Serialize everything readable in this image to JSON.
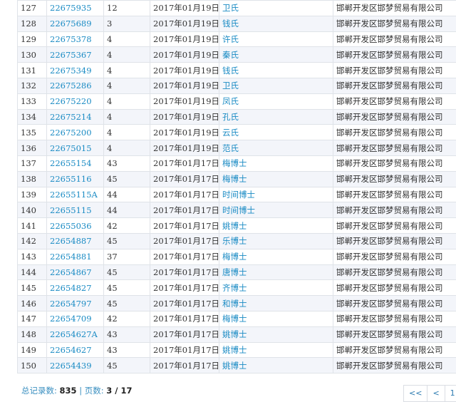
{
  "rows": [
    {
      "idx": "127",
      "reg": "22675935",
      "cls": "12",
      "date": "2017年01月19日",
      "name": "卫氏",
      "owner": "邯郸开发区邯梦贸易有限公司"
    },
    {
      "idx": "128",
      "reg": "22675689",
      "cls": "3",
      "date": "2017年01月19日",
      "name": "钱氏",
      "owner": "邯郸开发区邯梦贸易有限公司"
    },
    {
      "idx": "129",
      "reg": "22675378",
      "cls": "4",
      "date": "2017年01月19日",
      "name": "许氏",
      "owner": "邯郸开发区邯梦贸易有限公司"
    },
    {
      "idx": "130",
      "reg": "22675367",
      "cls": "4",
      "date": "2017年01月19日",
      "name": "秦氏",
      "owner": "邯郸开发区邯梦贸易有限公司"
    },
    {
      "idx": "131",
      "reg": "22675349",
      "cls": "4",
      "date": "2017年01月19日",
      "name": "钱氏",
      "owner": "邯郸开发区邯梦贸易有限公司"
    },
    {
      "idx": "132",
      "reg": "22675286",
      "cls": "4",
      "date": "2017年01月19日",
      "name": "卫氏",
      "owner": "邯郸开发区邯梦贸易有限公司"
    },
    {
      "idx": "133",
      "reg": "22675220",
      "cls": "4",
      "date": "2017年01月19日",
      "name": "凤氏",
      "owner": "邯郸开发区邯梦贸易有限公司"
    },
    {
      "idx": "134",
      "reg": "22675214",
      "cls": "4",
      "date": "2017年01月19日",
      "name": "孔氏",
      "owner": "邯郸开发区邯梦贸易有限公司"
    },
    {
      "idx": "135",
      "reg": "22675200",
      "cls": "4",
      "date": "2017年01月19日",
      "name": "云氏",
      "owner": "邯郸开发区邯梦贸易有限公司"
    },
    {
      "idx": "136",
      "reg": "22675015",
      "cls": "4",
      "date": "2017年01月19日",
      "name": "范氏",
      "owner": "邯郸开发区邯梦贸易有限公司"
    },
    {
      "idx": "137",
      "reg": "22655154",
      "cls": "43",
      "date": "2017年01月17日",
      "name": "梅博士",
      "owner": "邯郸开发区邯梦贸易有限公司"
    },
    {
      "idx": "138",
      "reg": "22655116",
      "cls": "45",
      "date": "2017年01月17日",
      "name": "梅博士",
      "owner": "邯郸开发区邯梦贸易有限公司"
    },
    {
      "idx": "139",
      "reg": "22655115A",
      "cls": "44",
      "date": "2017年01月17日",
      "name": "时间博士",
      "owner": "邯郸开发区邯梦贸易有限公司"
    },
    {
      "idx": "140",
      "reg": "22655115",
      "cls": "44",
      "date": "2017年01月17日",
      "name": "时间博士",
      "owner": "邯郸开发区邯梦贸易有限公司"
    },
    {
      "idx": "141",
      "reg": "22655036",
      "cls": "42",
      "date": "2017年01月17日",
      "name": "姚博士",
      "owner": "邯郸开发区邯梦贸易有限公司"
    },
    {
      "idx": "142",
      "reg": "22654887",
      "cls": "45",
      "date": "2017年01月17日",
      "name": "乐博士",
      "owner": "邯郸开发区邯梦贸易有限公司"
    },
    {
      "idx": "143",
      "reg": "22654881",
      "cls": "37",
      "date": "2017年01月17日",
      "name": "梅博士",
      "owner": "邯郸开发区邯梦贸易有限公司"
    },
    {
      "idx": "144",
      "reg": "22654867",
      "cls": "45",
      "date": "2017年01月17日",
      "name": "唐博士",
      "owner": "邯郸开发区邯梦贸易有限公司"
    },
    {
      "idx": "145",
      "reg": "22654827",
      "cls": "45",
      "date": "2017年01月17日",
      "name": "齐博士",
      "owner": "邯郸开发区邯梦贸易有限公司"
    },
    {
      "idx": "146",
      "reg": "22654797",
      "cls": "45",
      "date": "2017年01月17日",
      "name": "和博士",
      "owner": "邯郸开发区邯梦贸易有限公司"
    },
    {
      "idx": "147",
      "reg": "22654709",
      "cls": "42",
      "date": "2017年01月17日",
      "name": "梅博士",
      "owner": "邯郸开发区邯梦贸易有限公司"
    },
    {
      "idx": "148",
      "reg": "22654627A",
      "cls": "43",
      "date": "2017年01月17日",
      "name": "姚博士",
      "owner": "邯郸开发区邯梦贸易有限公司"
    },
    {
      "idx": "149",
      "reg": "22654627",
      "cls": "43",
      "date": "2017年01月17日",
      "name": "姚博士",
      "owner": "邯郸开发区邯梦贸易有限公司"
    },
    {
      "idx": "150",
      "reg": "22654439",
      "cls": "45",
      "date": "2017年01月17日",
      "name": "姚博士",
      "owner": "邯郸开发区邯梦贸易有限公司"
    }
  ],
  "footer": {
    "total_label": "总记录数:",
    "total_value": "835",
    "separator": "|",
    "page_label": "页数:",
    "page_value": "3 / 17"
  },
  "pager": {
    "first": "<<",
    "prev": "<",
    "page1": "1"
  }
}
